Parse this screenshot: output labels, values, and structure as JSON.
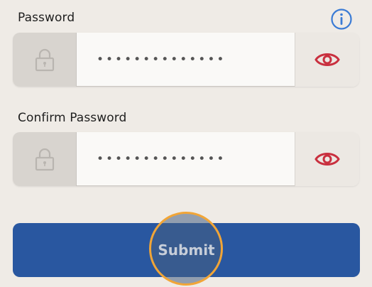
{
  "form": {
    "password": {
      "label": "Password",
      "value": "••••••••••••••"
    },
    "confirm_password": {
      "label": "Confirm Password",
      "value": "••••••••••••••"
    },
    "submit_label": "Submit"
  },
  "icons": {
    "info": "info-icon",
    "lock": "lock-icon",
    "show_password": "eye-icon"
  },
  "colors": {
    "background": "#efebe6",
    "primary_button": "#2957a0",
    "focus_ring": "#f1a537",
    "eye_icon": "#c9303f",
    "info_icon": "#3a7bd5"
  }
}
